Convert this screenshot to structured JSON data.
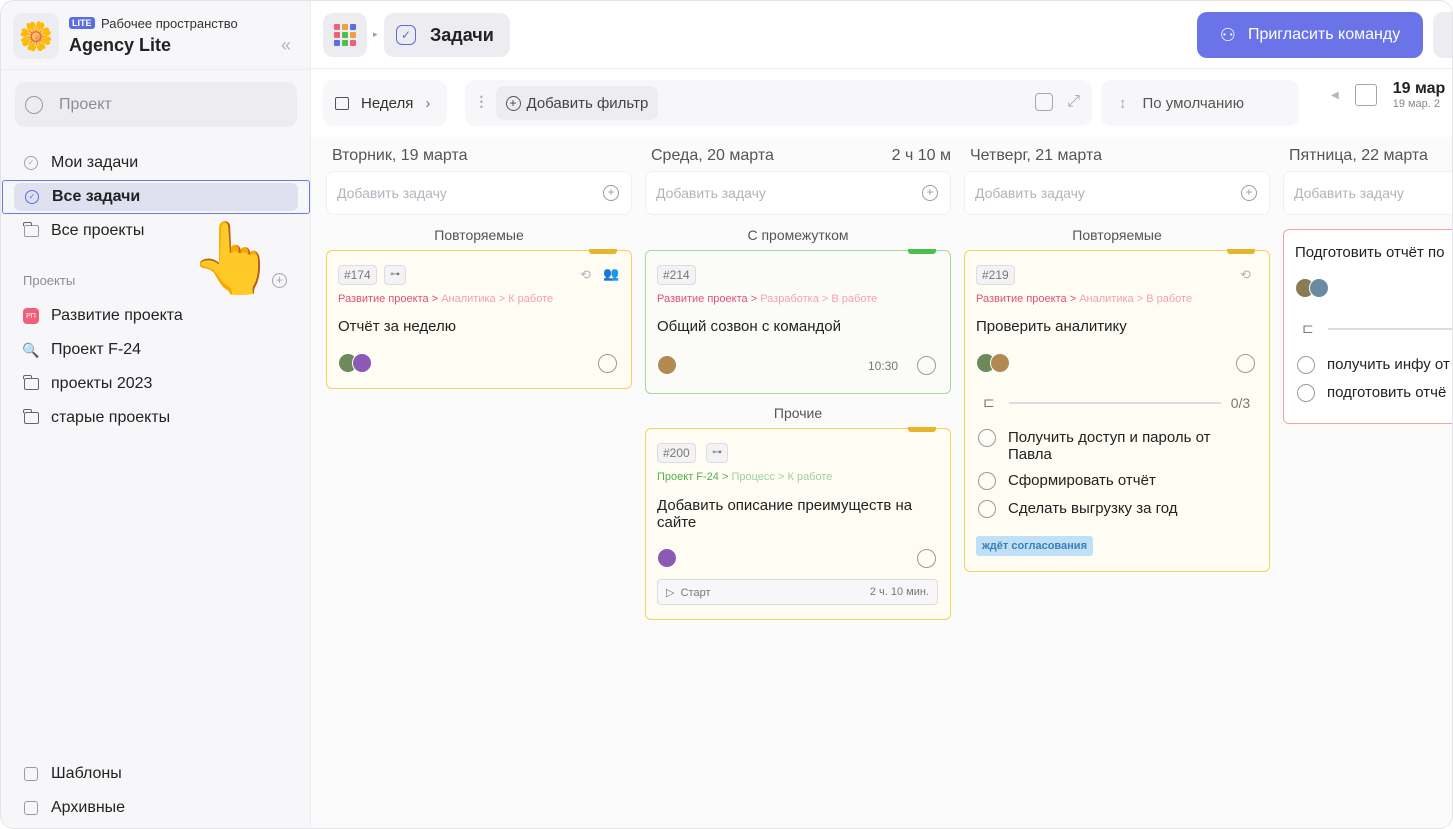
{
  "workspace": {
    "badge": "LITE",
    "subtitle": "Рабочее пространство",
    "name": "Agency Lite"
  },
  "search": {
    "placeholder": "Проект"
  },
  "nav": {
    "my_tasks": "Мои задачи",
    "all_tasks": "Все задачи",
    "all_projects": "Все проекты"
  },
  "projects": {
    "heading": "Проекты",
    "items": [
      {
        "label": "Развитие проекта",
        "badge": "РП"
      },
      {
        "label": "Проект F-24"
      },
      {
        "label": "проекты 2023"
      },
      {
        "label": "старые проекты"
      }
    ]
  },
  "bottom_nav": {
    "templates": "Шаблоны",
    "archive": "Архивные"
  },
  "topbar": {
    "title": "Задачи",
    "invite_label": "Пригласить команду",
    "apps_colors": [
      "#f0607a",
      "#f0a13a",
      "#5b6ee1",
      "#f0607a",
      "#4cbf4c",
      "#f0a13a",
      "#5b6ee1",
      "#4cbf4c",
      "#f0607a"
    ]
  },
  "toolbar": {
    "view": "Неделя",
    "add_filter": "Добавить фильтр",
    "sort": "По умолчанию",
    "date_main": "19 мар",
    "date_sub": "19 мар. 2"
  },
  "add_task_placeholder": "Добавить задачу",
  "columns": [
    {
      "day": "Вторник, 19 марта",
      "duration": "",
      "groups": [
        {
          "name": "Повторяемые",
          "cards": [
            {
              "id": "#174",
              "crumb": [
                "Развитие проекта",
                "Аналитика",
                "К работе"
              ],
              "title": "Отчёт за неделю"
            }
          ]
        }
      ]
    },
    {
      "day": "Среда, 20 марта",
      "duration": "2 ч 10 м",
      "groups": [
        {
          "name": "С промежутком",
          "cards": [
            {
              "id": "#214",
              "crumb": [
                "Развитие проекта",
                "Разработка",
                "В работе"
              ],
              "title": "Общий созвон с командой",
              "time": "10:30"
            }
          ]
        },
        {
          "name": "Прочие",
          "cards": [
            {
              "id": "#200",
              "crumb": [
                "Проект F-24",
                "Процесс",
                "К работе"
              ],
              "title": "Добавить описание преимуществ на сайте",
              "start_label": "Старт",
              "start_time": "2 ч. 10 мин."
            }
          ]
        }
      ]
    },
    {
      "day": "Четверг, 21 марта",
      "duration": "",
      "groups": [
        {
          "name": "Повторяемые",
          "cards": [
            {
              "id": "#219",
              "crumb": [
                "Развитие проекта",
                "Аналитика",
                "В работе"
              ],
              "title": "Проверить аналитику",
              "progress": "0/3",
              "subtasks": [
                "Получить доступ и пароль от Павла",
                "Сформировать отчёт",
                "Сделать выгрузку за год"
              ],
              "badge": "ждёт согласования"
            }
          ]
        }
      ]
    },
    {
      "day": "Пятница, 22 марта",
      "duration": "",
      "groups": [
        {
          "name": "",
          "cards": [
            {
              "title": "Подготовить отчёт по",
              "subtasks": [
                "получить инфу от",
                "подготовить отчё"
              ]
            }
          ]
        }
      ]
    }
  ]
}
